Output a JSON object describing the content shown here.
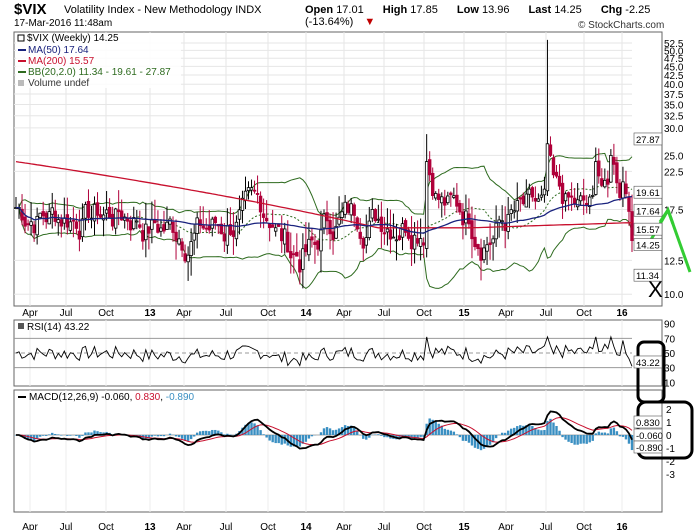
{
  "header": {
    "symbol": "$VIX",
    "name": "Volatility Index - New Methodology",
    "exchange": "INDX",
    "timestamp": "17-Mar-2016 11:48am",
    "source": "© StockCharts.com",
    "open_label": "Open",
    "open": "17.01",
    "high_label": "High",
    "high": "17.85",
    "low_label": "Low",
    "low": "13.96",
    "last_label": "Last",
    "last": "14.25",
    "chg_label": "Chg",
    "chg": "-2.25 (-13.64%)"
  },
  "legend": {
    "price": "$VIX (Weekly) 14.25",
    "ma50": "MA(50) 17.64",
    "ma200": "MA(200) 15.57",
    "bb": "BB(20,2.0) 11.34 - 19.61 - 27.87",
    "volume": "Volume undef"
  },
  "rsi_legend": "RSI(14) 43.22",
  "macd_legend": {
    "prefix": "MACD(12,26,9) -0.060, ",
    "signal": "0.830",
    "sep": ", ",
    "hist": "-0.890"
  },
  "colors": {
    "ma50": "#1a237e",
    "ma200": "#c8102e",
    "bb": "#2e6b1f",
    "candle_up": "#000000",
    "candle_down": "#b0003a",
    "macd_hist": "#3a8fc2",
    "green_arrow": "#33cc33"
  },
  "price_axis": [
    "52.5",
    "50.0",
    "47.5",
    "45.0",
    "42.5",
    "40.0",
    "37.5",
    "35.0",
    "32.5",
    "30.0",
    "25.0",
    "22.5",
    "17.5",
    "12.5",
    "10.0"
  ],
  "price_tags": {
    "bb_upper": "27.87",
    "bb_mid": "19.61",
    "ma50": "17.64",
    "ma200": "15.57",
    "last": "14.25",
    "bb_lower": "11.34"
  },
  "rsi_axis": [
    "90",
    "70",
    "50",
    "30",
    "10"
  ],
  "rsi_tag": "43.22",
  "macd_axis": [
    "2",
    "1",
    "0",
    "-1",
    "-2",
    "-3"
  ],
  "macd_tags": {
    "signal": "0.830",
    "macd": "-0.060",
    "hist": "-0.890"
  },
  "x_axis": [
    "Apr",
    "Jul",
    "Oct",
    "13",
    "Apr",
    "Jul",
    "Oct",
    "14",
    "Apr",
    "Jul",
    "Oct",
    "15",
    "Apr",
    "Jul",
    "Oct",
    "16"
  ],
  "annotation_x": "X"
}
